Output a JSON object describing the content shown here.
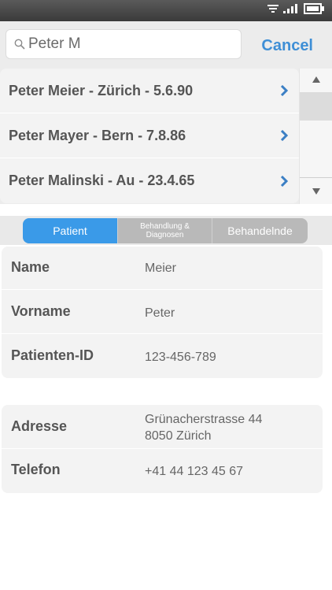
{
  "search": {
    "value": "Peter M",
    "cancel_label": "Cancel"
  },
  "results": [
    {
      "label": "Peter Meier - Zürich - 5.6.90"
    },
    {
      "label": "Peter Mayer - Bern - 7.8.86"
    },
    {
      "label": "Peter Malinski - Au - 23.4.65"
    }
  ],
  "tabs": [
    {
      "label": "Patient"
    },
    {
      "label_line1": "Behandlung &",
      "label_line2": "Diagnosen"
    },
    {
      "label": "Behandelnde"
    }
  ],
  "patient": {
    "name_label": "Name",
    "name_value": "Meier",
    "vorname_label": "Vorname",
    "vorname_value": "Peter",
    "id_label": "Patienten-ID",
    "id_value": "123-456-789"
  },
  "contact": {
    "adresse_label": "Adresse",
    "adresse_line1": "Grünacherstrasse 44",
    "adresse_line2": "8050 Zürich",
    "telefon_label": "Telefon",
    "telefon_value": "+41 44 123 45 67"
  },
  "colors": {
    "accent": "#3a9ae8",
    "link": "#3f8fd6",
    "chevron": "#3b7fc4"
  }
}
